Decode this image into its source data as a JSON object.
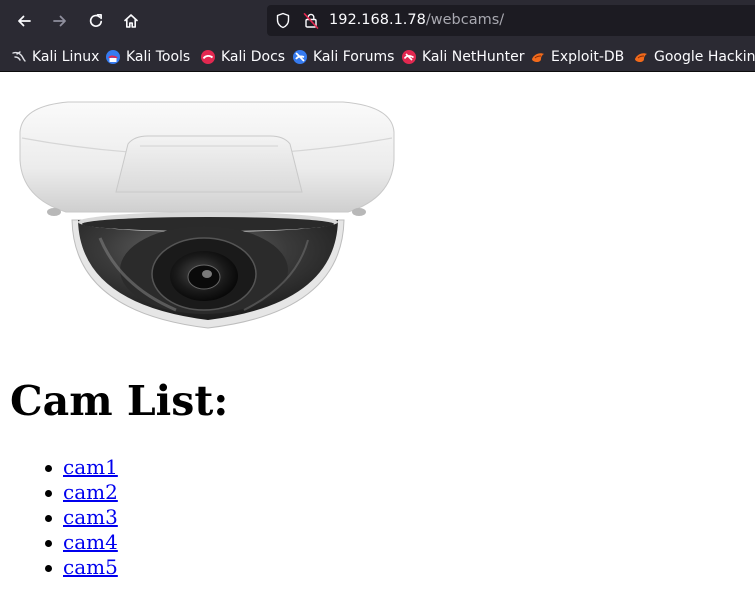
{
  "browser": {
    "url_host": "192.168.1.78",
    "url_path": "/webcams/",
    "bookmarks": [
      {
        "label": "Kali Linux",
        "icon": "kali-dragon-icon"
      },
      {
        "label": "Kali Tools",
        "icon": "kali-tools-icon"
      },
      {
        "label": "Kali Docs",
        "icon": "kali-docs-icon"
      },
      {
        "label": "Kali Forums",
        "icon": "kali-forums-icon"
      },
      {
        "label": "Kali NetHunter",
        "icon": "kali-nethunter-icon"
      },
      {
        "label": "Exploit-DB",
        "icon": "exploit-db-icon"
      },
      {
        "label": "Google Hacking",
        "icon": "google-hacking-icon"
      }
    ]
  },
  "page": {
    "heading": "Cam List:",
    "cams": [
      {
        "label": "cam1"
      },
      {
        "label": "cam2"
      },
      {
        "label": "cam3"
      },
      {
        "label": "cam4"
      },
      {
        "label": "cam5"
      }
    ]
  },
  "colors": {
    "toolbar_bg": "#2b2a33",
    "urlbar_bg": "#1c1b22",
    "link": "#0000ee"
  }
}
